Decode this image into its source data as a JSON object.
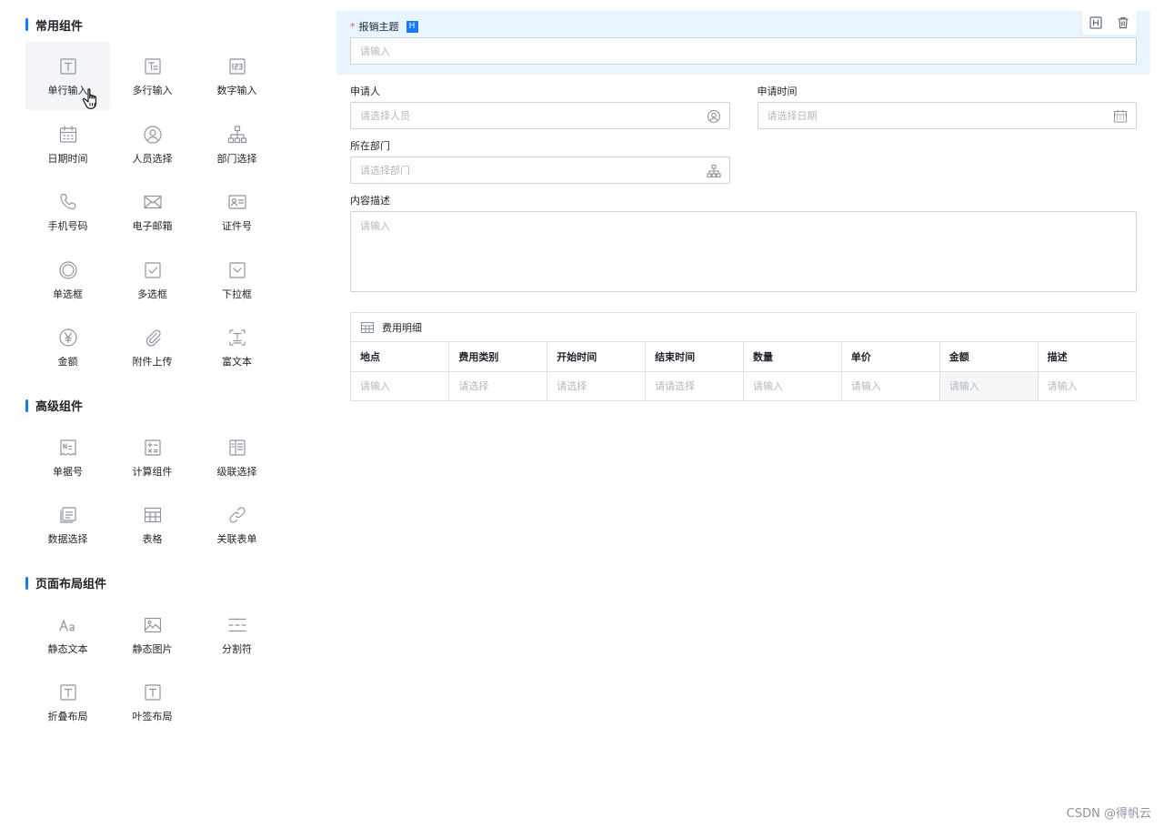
{
  "palette": {
    "common_title": "常用组件",
    "common": [
      {
        "label": "单行输入",
        "icon": "text-input-icon"
      },
      {
        "label": "多行输入",
        "icon": "multiline-input-icon"
      },
      {
        "label": "数字输入",
        "icon": "number-input-icon"
      },
      {
        "label": "日期时间",
        "icon": "calendar-icon"
      },
      {
        "label": "人员选择",
        "icon": "user-icon"
      },
      {
        "label": "部门选择",
        "icon": "org-tree-icon"
      },
      {
        "label": "手机号码",
        "icon": "phone-icon"
      },
      {
        "label": "电子邮箱",
        "icon": "mail-icon"
      },
      {
        "label": "证件号",
        "icon": "id-card-icon"
      },
      {
        "label": "单选框",
        "icon": "radio-icon"
      },
      {
        "label": "多选框",
        "icon": "checkbox-icon"
      },
      {
        "label": "下拉框",
        "icon": "dropdown-icon"
      },
      {
        "label": "金额",
        "icon": "yen-icon"
      },
      {
        "label": "附件上传",
        "icon": "paperclip-icon"
      },
      {
        "label": "富文本",
        "icon": "rich-text-icon"
      }
    ],
    "advanced_title": "高级组件",
    "advanced": [
      {
        "label": "单据号",
        "icon": "serial-number-icon"
      },
      {
        "label": "计算组件",
        "icon": "calculator-icon"
      },
      {
        "label": "级联选择",
        "icon": "cascade-icon"
      },
      {
        "label": "数据选择",
        "icon": "data-select-icon"
      },
      {
        "label": "表格",
        "icon": "table-icon"
      },
      {
        "label": "关联表单",
        "icon": "link-icon"
      }
    ],
    "layout_title": "页面布局组件",
    "layout": [
      {
        "label": "静态文本",
        "icon": "static-text-icon"
      },
      {
        "label": "静态图片",
        "icon": "image-icon"
      },
      {
        "label": "分割符",
        "icon": "divider-icon"
      },
      {
        "label": "折叠布局",
        "icon": "collapse-layout-icon"
      },
      {
        "label": "叶签布局",
        "icon": "tab-layout-icon"
      }
    ]
  },
  "form": {
    "subject": {
      "label": "报销主题",
      "required_mark": "*",
      "badge": "H",
      "placeholder": "请输入"
    },
    "applicant": {
      "label": "申请人",
      "placeholder": "请选择人员"
    },
    "apply_time": {
      "label": "申请时间",
      "placeholder": "请选择日期"
    },
    "department": {
      "label": "所在部门",
      "placeholder": "请选择部门"
    },
    "description": {
      "label": "内容描述",
      "placeholder": "请输入"
    },
    "detail": {
      "title": "费用明细",
      "columns": [
        "地点",
        "费用类别",
        "开始时间",
        "结束时间",
        "数量",
        "单价",
        "金额",
        "描述"
      ],
      "placeholders": [
        "请输入",
        "请选择",
        "请选择",
        "请请选择",
        "请输入",
        "请输入",
        "请输入",
        "请输入"
      ]
    }
  },
  "watermark": "CSDN @得帆云",
  "colors": {
    "accent": "#1677ff",
    "selected_bg": "#e8f4ff",
    "required": "#f54a45"
  }
}
